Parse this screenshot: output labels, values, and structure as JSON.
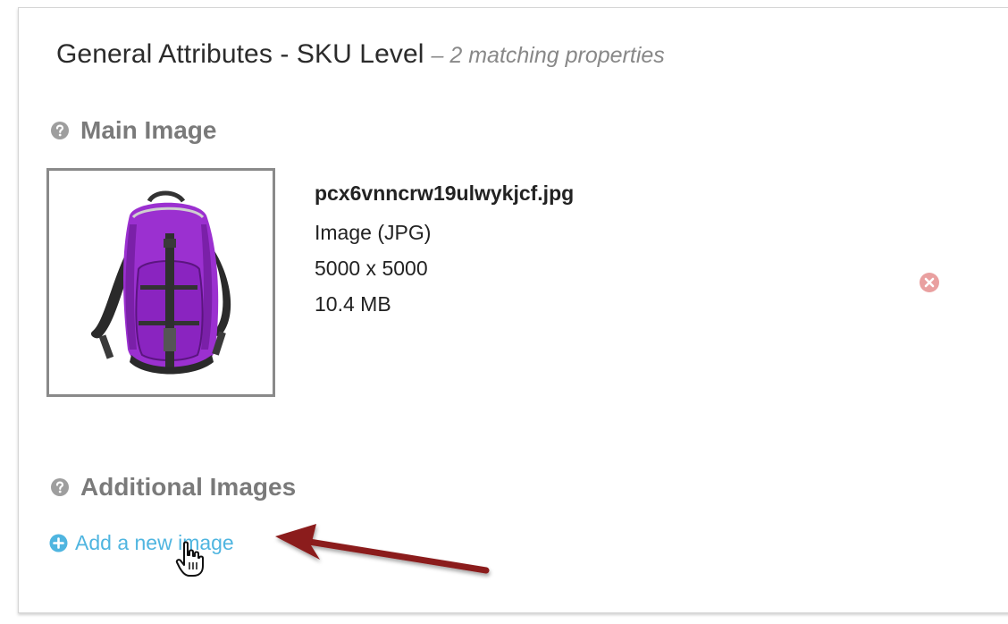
{
  "header": {
    "title": "General Attributes - SKU Level",
    "subtitle": "– 2 matching properties"
  },
  "main_image": {
    "label": "Main Image",
    "file_name": "pcx6vnncrw19ulwykjcf.jpg",
    "file_type": "Image (JPG)",
    "dimensions": "5000 x 5000",
    "file_size": "10.4 MB"
  },
  "additional_images": {
    "label": "Additional Images",
    "add_link_label": "Add a new image"
  },
  "colors": {
    "link": "#4fb5e0",
    "remove_icon": "#e9a0a0",
    "arrow": "#8b1a1a",
    "backpack": "#9b30d0"
  },
  "icons": {
    "help": "question-circle-icon",
    "remove": "remove-circle-icon",
    "add": "plus-circle-icon",
    "cursor": "hand-pointer-cursor"
  }
}
